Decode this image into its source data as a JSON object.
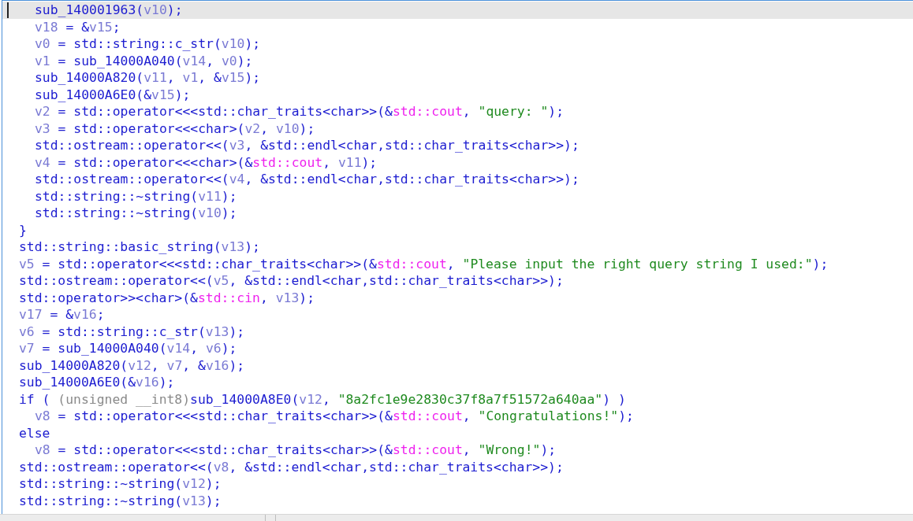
{
  "code_view": {
    "lines": [
      {
        "selected": true,
        "indented": true,
        "tokens": [
          {
            "kind": "code",
            "text": "sub_140001963("
          },
          {
            "kind": "var",
            "text": "v10"
          },
          {
            "kind": "code",
            "text": ");"
          }
        ]
      },
      {
        "selected": false,
        "indented": true,
        "tokens": [
          {
            "kind": "var",
            "text": "v18"
          },
          {
            "kind": "code",
            "text": " = &"
          },
          {
            "kind": "var",
            "text": "v15"
          },
          {
            "kind": "code",
            "text": ";"
          }
        ]
      },
      {
        "selected": false,
        "indented": true,
        "tokens": [
          {
            "kind": "var",
            "text": "v0"
          },
          {
            "kind": "code",
            "text": " = std::string::c_str("
          },
          {
            "kind": "var",
            "text": "v10"
          },
          {
            "kind": "code",
            "text": ");"
          }
        ]
      },
      {
        "selected": false,
        "indented": true,
        "tokens": [
          {
            "kind": "var",
            "text": "v1"
          },
          {
            "kind": "code",
            "text": " = sub_14000A040("
          },
          {
            "kind": "var",
            "text": "v14"
          },
          {
            "kind": "code",
            "text": ", "
          },
          {
            "kind": "var",
            "text": "v0"
          },
          {
            "kind": "code",
            "text": ");"
          }
        ]
      },
      {
        "selected": false,
        "indented": true,
        "tokens": [
          {
            "kind": "code",
            "text": "sub_14000A820("
          },
          {
            "kind": "var",
            "text": "v11"
          },
          {
            "kind": "code",
            "text": ", "
          },
          {
            "kind": "var",
            "text": "v1"
          },
          {
            "kind": "code",
            "text": ", &"
          },
          {
            "kind": "var",
            "text": "v15"
          },
          {
            "kind": "code",
            "text": ");"
          }
        ]
      },
      {
        "selected": false,
        "indented": true,
        "tokens": [
          {
            "kind": "code",
            "text": "sub_14000A6E0(&"
          },
          {
            "kind": "var",
            "text": "v15"
          },
          {
            "kind": "code",
            "text": ");"
          }
        ]
      },
      {
        "selected": false,
        "indented": true,
        "tokens": [
          {
            "kind": "var",
            "text": "v2"
          },
          {
            "kind": "code",
            "text": " = std::operator<<<std::char_traits<char>>(&"
          },
          {
            "kind": "global",
            "text": "std::cout"
          },
          {
            "kind": "code",
            "text": ", "
          },
          {
            "kind": "string",
            "text": "\"query: \""
          },
          {
            "kind": "code",
            "text": ");"
          }
        ]
      },
      {
        "selected": false,
        "indented": true,
        "tokens": [
          {
            "kind": "var",
            "text": "v3"
          },
          {
            "kind": "code",
            "text": " = std::operator<<<char>("
          },
          {
            "kind": "var",
            "text": "v2"
          },
          {
            "kind": "code",
            "text": ", "
          },
          {
            "kind": "var",
            "text": "v10"
          },
          {
            "kind": "code",
            "text": ");"
          }
        ]
      },
      {
        "selected": false,
        "indented": true,
        "tokens": [
          {
            "kind": "code",
            "text": "std::ostream::operator<<("
          },
          {
            "kind": "var",
            "text": "v3"
          },
          {
            "kind": "code",
            "text": ", &std::endl<char,std::char_traits<char>>);"
          }
        ]
      },
      {
        "selected": false,
        "indented": true,
        "tokens": [
          {
            "kind": "var",
            "text": "v4"
          },
          {
            "kind": "code",
            "text": " = std::operator<<<char>(&"
          },
          {
            "kind": "global",
            "text": "std::cout"
          },
          {
            "kind": "code",
            "text": ", "
          },
          {
            "kind": "var",
            "text": "v11"
          },
          {
            "kind": "code",
            "text": ");"
          }
        ]
      },
      {
        "selected": false,
        "indented": true,
        "tokens": [
          {
            "kind": "code",
            "text": "std::ostream::operator<<("
          },
          {
            "kind": "var",
            "text": "v4"
          },
          {
            "kind": "code",
            "text": ", &std::endl<char,std::char_traits<char>>);"
          }
        ]
      },
      {
        "selected": false,
        "indented": true,
        "tokens": [
          {
            "kind": "code",
            "text": "std::string::~string("
          },
          {
            "kind": "var",
            "text": "v11"
          },
          {
            "kind": "code",
            "text": ");"
          }
        ]
      },
      {
        "selected": false,
        "indented": true,
        "tokens": [
          {
            "kind": "code",
            "text": "std::string::~string("
          },
          {
            "kind": "var",
            "text": "v10"
          },
          {
            "kind": "code",
            "text": ");"
          }
        ]
      },
      {
        "selected": false,
        "tokens": [
          {
            "kind": "code",
            "text": "}"
          }
        ]
      },
      {
        "selected": false,
        "tokens": [
          {
            "kind": "code",
            "text": "std::string::basic_string("
          },
          {
            "kind": "var",
            "text": "v13"
          },
          {
            "kind": "code",
            "text": ");"
          }
        ]
      },
      {
        "selected": false,
        "tokens": [
          {
            "kind": "var",
            "text": "v5"
          },
          {
            "kind": "code",
            "text": " = std::operator<<<std::char_traits<char>>(&"
          },
          {
            "kind": "global",
            "text": "std::cout"
          },
          {
            "kind": "code",
            "text": ", "
          },
          {
            "kind": "string",
            "text": "\"Please input the right query string I used:\""
          },
          {
            "kind": "code",
            "text": ");"
          }
        ]
      },
      {
        "selected": false,
        "tokens": [
          {
            "kind": "code",
            "text": "std::ostream::operator<<("
          },
          {
            "kind": "var",
            "text": "v5"
          },
          {
            "kind": "code",
            "text": ", &std::endl<char,std::char_traits<char>>);"
          }
        ]
      },
      {
        "selected": false,
        "tokens": [
          {
            "kind": "code",
            "text": "std::operator>><char>(&"
          },
          {
            "kind": "global",
            "text": "std::cin"
          },
          {
            "kind": "code",
            "text": ", "
          },
          {
            "kind": "var",
            "text": "v13"
          },
          {
            "kind": "code",
            "text": ");"
          }
        ]
      },
      {
        "selected": false,
        "tokens": [
          {
            "kind": "var",
            "text": "v17"
          },
          {
            "kind": "code",
            "text": " = &"
          },
          {
            "kind": "var",
            "text": "v16"
          },
          {
            "kind": "code",
            "text": ";"
          }
        ]
      },
      {
        "selected": false,
        "tokens": [
          {
            "kind": "var",
            "text": "v6"
          },
          {
            "kind": "code",
            "text": " = std::string::c_str("
          },
          {
            "kind": "var",
            "text": "v13"
          },
          {
            "kind": "code",
            "text": ");"
          }
        ]
      },
      {
        "selected": false,
        "tokens": [
          {
            "kind": "var",
            "text": "v7"
          },
          {
            "kind": "code",
            "text": " = sub_14000A040("
          },
          {
            "kind": "var",
            "text": "v14"
          },
          {
            "kind": "code",
            "text": ", "
          },
          {
            "kind": "var",
            "text": "v6"
          },
          {
            "kind": "code",
            "text": ");"
          }
        ]
      },
      {
        "selected": false,
        "tokens": [
          {
            "kind": "code",
            "text": "sub_14000A820("
          },
          {
            "kind": "var",
            "text": "v12"
          },
          {
            "kind": "code",
            "text": ", "
          },
          {
            "kind": "var",
            "text": "v7"
          },
          {
            "kind": "code",
            "text": ", &"
          },
          {
            "kind": "var",
            "text": "v16"
          },
          {
            "kind": "code",
            "text": ");"
          }
        ]
      },
      {
        "selected": false,
        "tokens": [
          {
            "kind": "code",
            "text": "sub_14000A6E0(&"
          },
          {
            "kind": "var",
            "text": "v16"
          },
          {
            "kind": "code",
            "text": ");"
          }
        ]
      },
      {
        "selected": false,
        "tokens": [
          {
            "kind": "code",
            "text": "if ( "
          },
          {
            "kind": "cast",
            "text": "(unsigned __int8)"
          },
          {
            "kind": "code",
            "text": "sub_14000A8E0("
          },
          {
            "kind": "var",
            "text": "v12"
          },
          {
            "kind": "code",
            "text": ", "
          },
          {
            "kind": "string",
            "text": "\"8a2fc1e9e2830c37f8a7f51572a640aa\""
          },
          {
            "kind": "code",
            "text": ") )"
          }
        ]
      },
      {
        "selected": false,
        "indented": true,
        "tokens": [
          {
            "kind": "var",
            "text": "v8"
          },
          {
            "kind": "code",
            "text": " = std::operator<<<std::char_traits<char>>(&"
          },
          {
            "kind": "global",
            "text": "std::cout"
          },
          {
            "kind": "code",
            "text": ", "
          },
          {
            "kind": "string",
            "text": "\"Congratulations!\""
          },
          {
            "kind": "code",
            "text": ");"
          }
        ]
      },
      {
        "selected": false,
        "tokens": [
          {
            "kind": "code",
            "text": "else"
          }
        ]
      },
      {
        "selected": false,
        "indented": true,
        "tokens": [
          {
            "kind": "var",
            "text": "v8"
          },
          {
            "kind": "code",
            "text": " = std::operator<<<std::char_traits<char>>(&"
          },
          {
            "kind": "global",
            "text": "std::cout"
          },
          {
            "kind": "code",
            "text": ", "
          },
          {
            "kind": "string",
            "text": "\"Wrong!\""
          },
          {
            "kind": "code",
            "text": ");"
          }
        ]
      },
      {
        "selected": false,
        "tokens": [
          {
            "kind": "code",
            "text": "std::ostream::operator<<("
          },
          {
            "kind": "var",
            "text": "v8"
          },
          {
            "kind": "code",
            "text": ", &std::endl<char,std::char_traits<char>>);"
          }
        ]
      },
      {
        "selected": false,
        "tokens": [
          {
            "kind": "code",
            "text": "std::string::~string("
          },
          {
            "kind": "var",
            "text": "v12"
          },
          {
            "kind": "code",
            "text": ");"
          }
        ]
      },
      {
        "selected": false,
        "tokens": [
          {
            "kind": "code",
            "text": "std::string::~string("
          },
          {
            "kind": "var",
            "text": "v13"
          },
          {
            "kind": "code",
            "text": ");"
          }
        ]
      }
    ]
  }
}
